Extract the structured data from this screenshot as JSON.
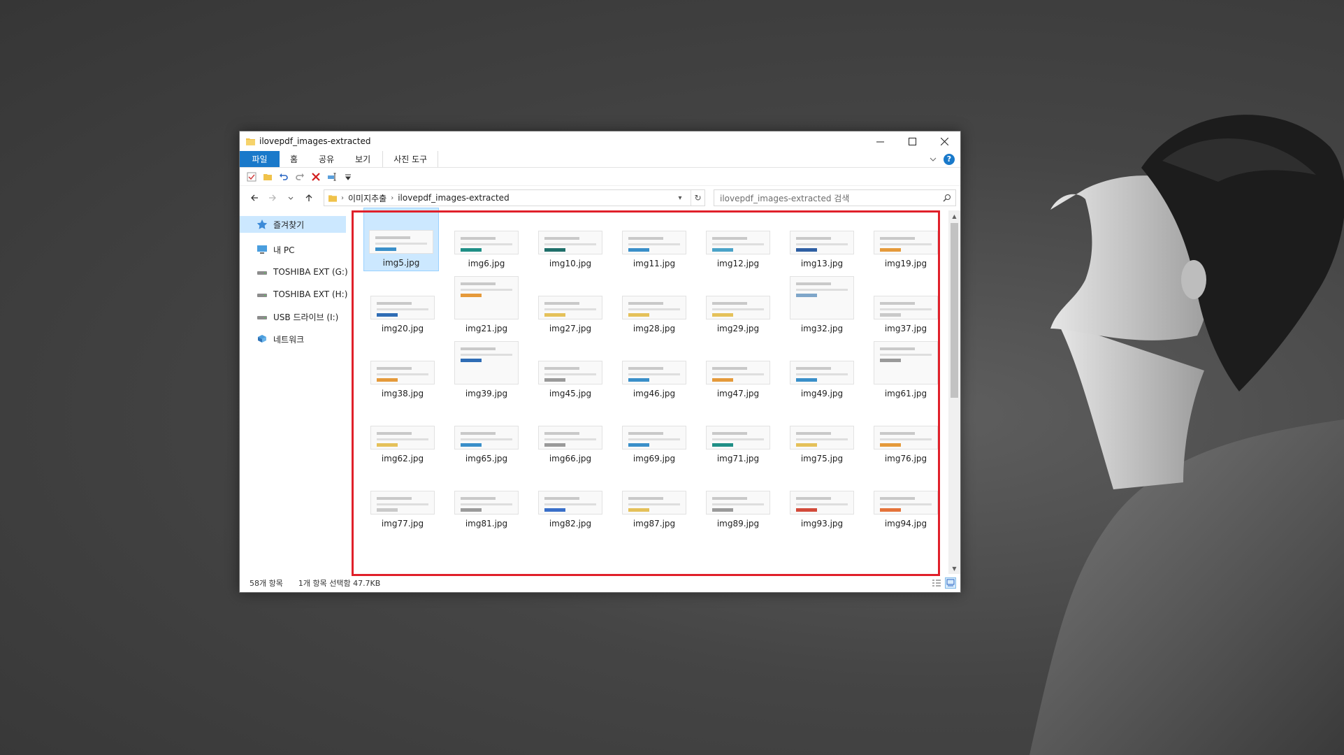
{
  "window": {
    "title": "ilovepdf_images-extracted"
  },
  "ribbon": {
    "tabs": [
      {
        "label": "파일"
      },
      {
        "label": "홈"
      },
      {
        "label": "공유"
      },
      {
        "label": "보기"
      },
      {
        "label": "사진 도구"
      }
    ]
  },
  "address": {
    "segments": [
      "이미지추출",
      "ilovepdf_images-extracted"
    ]
  },
  "search": {
    "placeholder": "ilovepdf_images-extracted 검색"
  },
  "nav_pane": {
    "items": [
      {
        "label": "즐겨찾기",
        "icon": "star-icon"
      },
      {
        "label": "내 PC",
        "icon": "pc-icon"
      },
      {
        "label": "TOSHIBA EXT (G:)",
        "icon": "drive-icon"
      },
      {
        "label": "TOSHIBA EXT (H:)",
        "icon": "drive-icon"
      },
      {
        "label": "USB 드라이브 (I:)",
        "icon": "drive-icon"
      },
      {
        "label": "네트워크",
        "icon": "network-icon"
      }
    ]
  },
  "files": [
    {
      "name": "img5.jpg",
      "accent": "#3a8fc9"
    },
    {
      "name": "img6.jpg",
      "accent": "#1f8f86"
    },
    {
      "name": "img10.jpg",
      "accent": "#1f6f6a"
    },
    {
      "name": "img11.jpg",
      "accent": "#3a8fc9"
    },
    {
      "name": "img12.jpg",
      "accent": "#4aa3c8"
    },
    {
      "name": "img13.jpg",
      "accent": "#2f5fa3"
    },
    {
      "name": "img19.jpg",
      "accent": "#e59a3b"
    },
    {
      "name": "img20.jpg",
      "accent": "#2f6db5"
    },
    {
      "name": "img21.jpg",
      "accent": "#e59a3b"
    },
    {
      "name": "img27.jpg",
      "accent": "#e5c15a"
    },
    {
      "name": "img28.jpg",
      "accent": "#e5c15a"
    },
    {
      "name": "img29.jpg",
      "accent": "#e5c15a"
    },
    {
      "name": "img32.jpg",
      "accent": "#7fa6c9"
    },
    {
      "name": "img37.jpg",
      "accent": "#c9c9c9"
    },
    {
      "name": "img38.jpg",
      "accent": "#e59a3b"
    },
    {
      "name": "img39.jpg",
      "accent": "#2f6db5"
    },
    {
      "name": "img45.jpg",
      "accent": "#9a9a9a"
    },
    {
      "name": "img46.jpg",
      "accent": "#3a8fc9"
    },
    {
      "name": "img47.jpg",
      "accent": "#e59a3b"
    },
    {
      "name": "img49.jpg",
      "accent": "#3a8fc9"
    },
    {
      "name": "img61.jpg",
      "accent": "#9a9a9a"
    },
    {
      "name": "img62.jpg",
      "accent": "#e5c15a"
    },
    {
      "name": "img65.jpg",
      "accent": "#3a8fc9"
    },
    {
      "name": "img66.jpg",
      "accent": "#9a9a9a"
    },
    {
      "name": "img69.jpg",
      "accent": "#3a8fc9"
    },
    {
      "name": "img71.jpg",
      "accent": "#1f8f86"
    },
    {
      "name": "img75.jpg",
      "accent": "#e5c15a"
    },
    {
      "name": "img76.jpg",
      "accent": "#e59a3b"
    },
    {
      "name": "img77.jpg",
      "accent": "#c9c9c9"
    },
    {
      "name": "img81.jpg",
      "accent": "#9a9a9a"
    },
    {
      "name": "img82.jpg",
      "accent": "#3a6fc9"
    },
    {
      "name": "img87.jpg",
      "accent": "#e5c15a"
    },
    {
      "name": "img89.jpg",
      "accent": "#9a9a9a"
    },
    {
      "name": "img93.jpg",
      "accent": "#d24a3a"
    },
    {
      "name": "img94.jpg",
      "accent": "#e5733a"
    }
  ],
  "selected_file": "img5.jpg",
  "status": {
    "count": "58개 항목",
    "selection": "1개 항목 선택함 47.7KB"
  },
  "colors": {
    "accent": "#1979ca",
    "selection": "#cce8ff",
    "highlight_box": "#e0202a"
  }
}
